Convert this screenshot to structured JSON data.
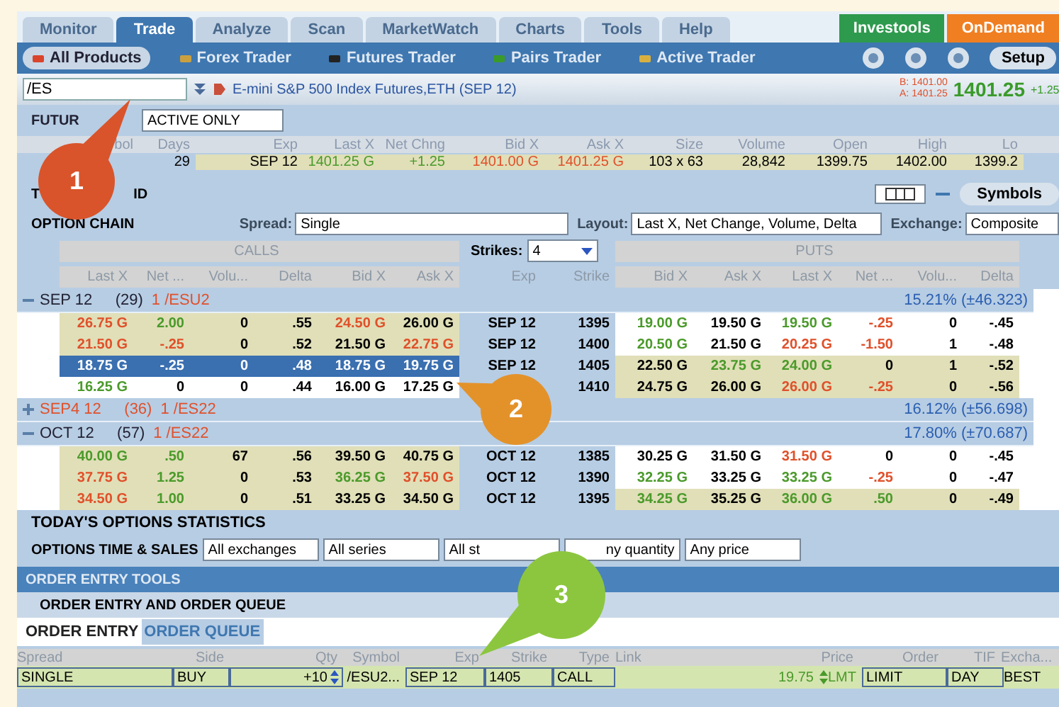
{
  "main_tabs": [
    {
      "label": "Monitor",
      "selected": false
    },
    {
      "label": "Trade",
      "selected": true
    },
    {
      "label": "Analyze",
      "selected": false
    },
    {
      "label": "Scan",
      "selected": false
    },
    {
      "label": "MarketWatch",
      "selected": false
    },
    {
      "label": "Charts",
      "selected": false
    },
    {
      "label": "Tools",
      "selected": false
    },
    {
      "label": "Help",
      "selected": false
    }
  ],
  "promo_buttons": [
    {
      "label": "Investools",
      "color": "#2e9a4e"
    },
    {
      "label": "OnDemand",
      "color": "#f07f22"
    }
  ],
  "sub_tabs": [
    {
      "label": "All Products",
      "selected": true
    },
    {
      "label": "Forex Trader",
      "selected": false
    },
    {
      "label": "Futures Trader",
      "selected": false
    },
    {
      "label": "Pairs Trader",
      "selected": false
    },
    {
      "label": "Active Trader",
      "selected": false
    }
  ],
  "setup_button": "Setup",
  "symbol_bar": {
    "symbol": "/ES",
    "description": "E-mini S&P 500 Index Futures,ETH (SEP 12)",
    "bid": "B: 1401.00",
    "ask": "A: 1401.25",
    "last": "1401.25",
    "change": "+1.25"
  },
  "futures": {
    "label": "FUTUR",
    "filter": "ACTIVE ONLY",
    "columns": [
      "bol",
      "Days",
      "Exp",
      "Last X",
      "Net Chng",
      "Bid X",
      "Ask X",
      "Size",
      "Volume",
      "Open",
      "High",
      "Lo"
    ],
    "row": [
      {
        "text": "29"
      },
      {
        "text": "SEP 12"
      },
      {
        "text": "1401.25 G",
        "color": "#4a9a2a"
      },
      {
        "text": "+1.25",
        "color": "#4a9a2a"
      },
      {
        "text": "1401.00 G",
        "color": "#e0502a"
      },
      {
        "text": "1401.25 G",
        "color": "#e0502a"
      },
      {
        "text": "103 x 63"
      },
      {
        "text": "28,842"
      },
      {
        "text": "1399.75"
      },
      {
        "text": "1402.00"
      },
      {
        "text": "1399.2"
      }
    ]
  },
  "trade_grid": {
    "label_start": "T",
    "label_end": "ID",
    "symbols_button": "Symbols"
  },
  "option_chain": {
    "label": "OPTION CHAIN",
    "spread_label": "Spread:",
    "spread": "Single",
    "layout_label": "Layout:",
    "layout": "Last X, Net Change, Volume, Delta",
    "exchange_label": "Exchange:",
    "exchange": "Composite",
    "calls_label": "CALLS",
    "puts_label": "PUTS",
    "strikes_label": "Strikes:",
    "strikes": "4",
    "columns": [
      "Last X",
      "Net ...",
      "Volu...",
      "Delta",
      "Bid X",
      "Ask X",
      "Exp",
      "Strike",
      "Bid X",
      "Ask X",
      "Last X",
      "Net ...",
      "Volu...",
      "Delta"
    ],
    "groups": [
      {
        "title": "SEP 12",
        "days": "(29)",
        "root": "1 /ESU2",
        "volatility": "15.21% (±46.323)",
        "expanded": true,
        "rows": [
          {
            "selected": false,
            "calls_itm": true,
            "puts_itm": false,
            "exp": "SEP 12",
            "strike": "1395",
            "calls": [
              {
                "text": "26.75 G",
                "color": "#e0502a"
              },
              {
                "text": "2.00",
                "color": "#4a9a2a"
              },
              {
                "text": "0"
              },
              {
                "text": ".55"
              },
              {
                "text": "24.50 G",
                "color": "#e0502a"
              },
              {
                "text": "26.00 G"
              }
            ],
            "puts": [
              {
                "text": "19.00 G",
                "color": "#4a9a2a"
              },
              {
                "text": "19.50 G"
              },
              {
                "text": "19.50 G",
                "color": "#4a9a2a"
              },
              {
                "text": "-.25",
                "color": "#e0502a"
              },
              {
                "text": "0"
              },
              {
                "text": "-.45"
              }
            ]
          },
          {
            "selected": false,
            "calls_itm": true,
            "puts_itm": false,
            "exp": "SEP 12",
            "strike": "1400",
            "calls": [
              {
                "text": "21.50 G",
                "color": "#e0502a"
              },
              {
                "text": "-.25",
                "color": "#e0502a"
              },
              {
                "text": "0"
              },
              {
                "text": ".52"
              },
              {
                "text": "21.50 G"
              },
              {
                "text": "22.75 G",
                "color": "#e0502a"
              }
            ],
            "puts": [
              {
                "text": "20.50 G",
                "color": "#4a9a2a"
              },
              {
                "text": "21.50 G"
              },
              {
                "text": "20.25 G",
                "color": "#e0502a"
              },
              {
                "text": "-1.50",
                "color": "#e0502a"
              },
              {
                "text": "1"
              },
              {
                "text": "-.48"
              }
            ]
          },
          {
            "selected": true,
            "calls_itm": false,
            "puts_itm": true,
            "exp": "SEP 12",
            "strike": "1405",
            "calls": [
              {
                "text": "18.75 G"
              },
              {
                "text": "-.25"
              },
              {
                "text": "0"
              },
              {
                "text": ".48"
              },
              {
                "text": "18.75 G"
              },
              {
                "text": "19.75 G"
              }
            ],
            "puts": [
              {
                "text": "22.50 G"
              },
              {
                "text": "23.75 G",
                "color": "#4a9a2a"
              },
              {
                "text": "24.00 G",
                "color": "#4a9a2a"
              },
              {
                "text": "0"
              },
              {
                "text": "1"
              },
              {
                "text": "-.52"
              }
            ]
          },
          {
            "selected": false,
            "calls_itm": false,
            "puts_itm": true,
            "strike": "1410",
            "calls": [
              {
                "text": "16.25 G",
                "color": "#4a9a2a"
              },
              {
                "text": "0"
              },
              {
                "text": "0"
              },
              {
                "text": ".44"
              },
              {
                "text": "16.00 G"
              },
              {
                "text": "17.25 G"
              }
            ],
            "puts": [
              {
                "text": "24.75 G"
              },
              {
                "text": "26.00 G"
              },
              {
                "text": "26.00 G",
                "color": "#e0502a"
              },
              {
                "text": "-.25",
                "color": "#e0502a"
              },
              {
                "text": "0"
              },
              {
                "text": "-.56"
              }
            ]
          }
        ]
      },
      {
        "title": "SEP4 12",
        "days": "(36)",
        "root": "1 /ES22",
        "volatility": "16.12% (±56.698)",
        "expanded": false,
        "alert": true
      },
      {
        "title": "OCT 12",
        "days": "(57)",
        "root": "1 /ES22",
        "volatility": "17.80% (±70.687)",
        "expanded": true,
        "rows": [
          {
            "selected": false,
            "calls_itm": true,
            "puts_itm": false,
            "exp": "OCT 12",
            "strike": "1385",
            "calls": [
              {
                "text": "40.00 G",
                "color": "#4a9a2a"
              },
              {
                "text": ".50",
                "color": "#4a9a2a"
              },
              {
                "text": "67"
              },
              {
                "text": ".56"
              },
              {
                "text": "39.50 G"
              },
              {
                "text": "40.75 G"
              }
            ],
            "puts": [
              {
                "text": "30.25 G"
              },
              {
                "text": "31.50 G"
              },
              {
                "text": "31.50 G",
                "color": "#e0502a"
              },
              {
                "text": "0"
              },
              {
                "text": "0"
              },
              {
                "text": "-.45"
              }
            ]
          },
          {
            "selected": false,
            "calls_itm": true,
            "puts_itm": false,
            "exp": "OCT 12",
            "strike": "1390",
            "calls": [
              {
                "text": "37.75 G",
                "color": "#e0502a"
              },
              {
                "text": "1.25",
                "color": "#4a9a2a"
              },
              {
                "text": "0"
              },
              {
                "text": ".53"
              },
              {
                "text": "36.25 G",
                "color": "#4a9a2a"
              },
              {
                "text": "37.50 G",
                "color": "#e0502a"
              }
            ],
            "puts": [
              {
                "text": "32.25 G",
                "color": "#4a9a2a"
              },
              {
                "text": "33.25 G"
              },
              {
                "text": "33.25 G",
                "color": "#4a9a2a"
              },
              {
                "text": "-.25",
                "color": "#e0502a"
              },
              {
                "text": "0"
              },
              {
                "text": "-.47"
              }
            ]
          },
          {
            "selected": false,
            "calls_itm": true,
            "puts_itm": true,
            "exp": "OCT 12",
            "strike": "1395",
            "calls": [
              {
                "text": "34.50 G",
                "color": "#e0502a"
              },
              {
                "text": "1.00",
                "color": "#4a9a2a"
              },
              {
                "text": "0"
              },
              {
                "text": ".51"
              },
              {
                "text": "33.25 G"
              },
              {
                "text": "34.50 G"
              }
            ],
            "puts": [
              {
                "text": "34.25 G",
                "color": "#4a9a2a"
              },
              {
                "text": "35.25 G"
              },
              {
                "text": "36.00 G",
                "color": "#4a9a2a"
              },
              {
                "text": ".50",
                "color": "#4a9a2a"
              },
              {
                "text": "0"
              },
              {
                "text": "-.49"
              }
            ]
          }
        ]
      }
    ]
  },
  "statistics_label": "TODAY'S OPTIONS STATISTICS",
  "time_and_sales": {
    "label": "OPTIONS TIME & SALES",
    "filters": [
      "All exchanges",
      "All series",
      "All st",
      "ny quantity",
      "Any price"
    ]
  },
  "order_tools": {
    "title": "ORDER ENTRY TOOLS",
    "section": "ORDER ENTRY AND ORDER QUEUE",
    "tabs": [
      {
        "label": "ORDER ENTRY",
        "selected": true
      },
      {
        "label": "ORDER QUEUE",
        "selected": false
      }
    ],
    "columns": [
      "Spread",
      "Side",
      "Qty",
      "Symbol",
      "Exp",
      "Strike",
      "Type",
      "Link",
      "Price",
      "Order",
      "TIF",
      "Excha..."
    ],
    "order": {
      "spread": "SINGLE",
      "side": "BUY",
      "qty": "+10",
      "symbol": "/ESU2...",
      "exp": "SEP 12",
      "strike": "1405",
      "type": "CALL",
      "price": "19.75",
      "price_type": "LMT",
      "order": "LIMIT",
      "tif": "DAY",
      "exchange": "BEST"
    }
  },
  "callouts": [
    {
      "number": "1",
      "color": "#d9542b"
    },
    {
      "number": "2",
      "color": "#e3922a"
    },
    {
      "number": "3",
      "color": "#8cc63f"
    }
  ]
}
